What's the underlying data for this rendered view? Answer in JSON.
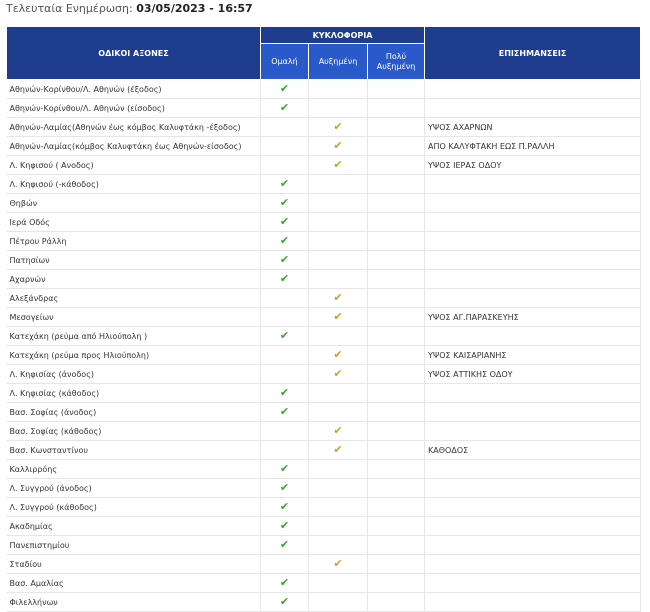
{
  "update": {
    "label": "Τελευταία Ενημέρωση:",
    "datetime": "03/05/2023 - 16:57"
  },
  "table": {
    "col_axes": "ΟΔΙΚΟΙ ΑΞΟΝΕΣ",
    "col_traffic": "ΚΥΚΛΟΦΟΡΙΑ",
    "col_normal": "Ομαλή",
    "col_increased": "Αυξημένη",
    "col_very_increased": "Πολύ Αυξημένη",
    "col_notes": "ΕΠΙΣΗΜΑΝΣΕΙΣ",
    "check_glyph": "✔",
    "colors": {
      "header": "#1f3d8f",
      "subheader": "#2a59c9",
      "normal": "#3aa33a",
      "increased": "#c8a228"
    },
    "rows": [
      {
        "road": "Αθηνών-Κορίνθου/Λ. Αθηνών (έξοδος)",
        "status": "normal",
        "note": ""
      },
      {
        "road": "Αθηνών-Κορίνθου/Λ. Αθηνών (είσοδος)",
        "status": "normal",
        "note": ""
      },
      {
        "road": "Αθηνών-Λαμίας(Αθηνών έως κόμβος Καλυφτάκη -έξοδος)",
        "status": "increased",
        "note": "ΥΨΟΣ ΑΧΑΡΝΩΝ"
      },
      {
        "road": "Αθηνών-Λαμίας(κόμβος Καλυφτάκη έως Αθηνών-είσοδος)",
        "status": "increased",
        "note": "ΑΠΟ ΚΑΛΥΦΤΑΚΗ ΕΩΣ Π.ΡΑΛΛΗ"
      },
      {
        "road": "Λ. Κηφισού ( Ανοδος)",
        "status": "increased",
        "note": "ΥΨΟΣ ΙΕΡΑΣ ΟΔΟΥ"
      },
      {
        "road": "Λ. Κηφισού (-κάθοδος)",
        "status": "normal",
        "note": ""
      },
      {
        "road": "Θηβών",
        "status": "normal",
        "note": ""
      },
      {
        "road": "Ιερά Οδός",
        "status": "normal",
        "note": ""
      },
      {
        "road": "Πέτρου Ράλλη",
        "status": "normal",
        "note": ""
      },
      {
        "road": "Πατησίων",
        "status": "normal",
        "note": ""
      },
      {
        "road": "Αχαρνών",
        "status": "normal",
        "note": ""
      },
      {
        "road": "Αλεξάνδρας",
        "status": "increased",
        "note": ""
      },
      {
        "road": "Μεσογείων",
        "status": "increased",
        "note": "ΥΨΟΣ ΑΓ.ΠΑΡΑΣΚΕΥΗΣ"
      },
      {
        "road": "Κατεχάκη (ρεύμα από Ηλιούπολη )",
        "status": "normal",
        "note": ""
      },
      {
        "road": "Κατεχάκη (ρεύμα προς Ηλιούπολη)",
        "status": "increased",
        "note": "ΥΨΟΣ ΚΑΙΣΑΡΙΑΝΗΣ"
      },
      {
        "road": "Λ. Κηφισίας (άνοδος)",
        "status": "increased",
        "note": "ΥΨΟΣ ΑΤΤΙΚΗΣ ΟΔΟΥ"
      },
      {
        "road": "Λ. Κηφισίας (κάθοδος)",
        "status": "normal",
        "note": ""
      },
      {
        "road": "Βασ. Σοφίας (άνοδος)",
        "status": "normal",
        "note": ""
      },
      {
        "road": "Βασ. Σοφίας (κάθοδος)",
        "status": "increased",
        "note": ""
      },
      {
        "road": "Βασ. Κωνσταντίνου",
        "status": "increased",
        "note": "ΚΑΘΟΔΟΣ"
      },
      {
        "road": "Καλλιρρόης",
        "status": "normal",
        "note": ""
      },
      {
        "road": "Λ. Συγγρού (άνοδος)",
        "status": "normal",
        "note": ""
      },
      {
        "road": "Λ. Συγγρού (κάθοδος)",
        "status": "normal",
        "note": ""
      },
      {
        "road": "Ακαδημίας",
        "status": "normal",
        "note": ""
      },
      {
        "road": "Πανεπιστημίου",
        "status": "normal",
        "note": ""
      },
      {
        "road": "Σταδίου",
        "status": "increased",
        "note": ""
      },
      {
        "road": "Βασ. Αμαλίας",
        "status": "normal",
        "note": ""
      },
      {
        "road": "Φιλελλήνων",
        "status": "normal",
        "note": ""
      }
    ]
  }
}
